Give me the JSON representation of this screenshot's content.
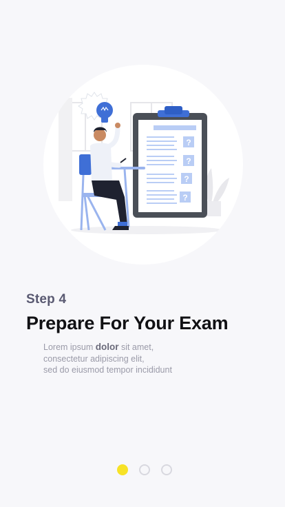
{
  "onboarding": {
    "step_label": "Step 4",
    "title": "Prepare For Your Exam",
    "description": {
      "part1": "Lorem ipsum ",
      "bold": "dolor",
      "part2": " sit amet,",
      "line2": "consectetur adipiscing elit,",
      "line3": "sed do eiusmod tempor incididunt"
    },
    "illustration_icon": "student-checklist-illustration",
    "pagination": {
      "total": 3,
      "active_index": 0,
      "active_color": "#f7e227",
      "inactive_color": "#d8d8df"
    },
    "checklist_marks": [
      "?",
      "?",
      "?",
      "?"
    ]
  }
}
